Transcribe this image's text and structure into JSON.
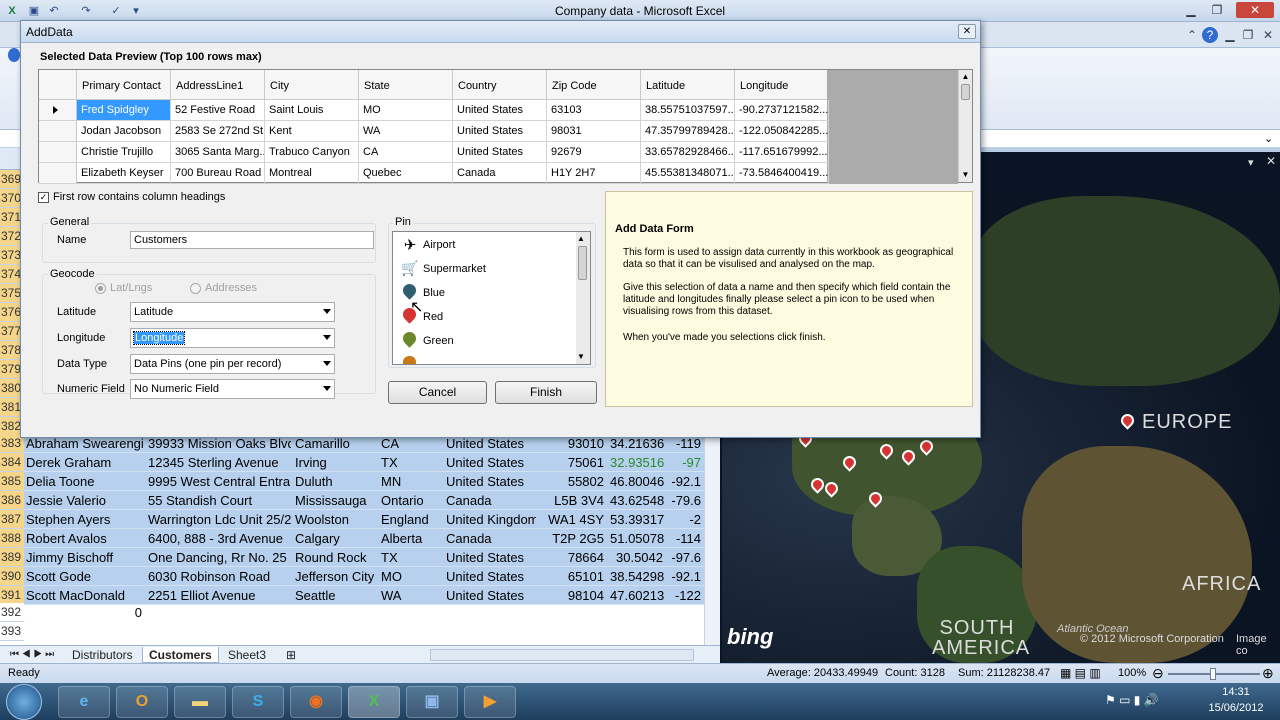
{
  "excel": {
    "window_title": "Company data - Microsoft Excel",
    "status_ready": "Ready",
    "status_average": "Average: 20433.49949",
    "status_count": "Count: 3128",
    "status_sum": "Sum: 21128238.47",
    "zoom": "100%",
    "sheet_tabs": [
      "Distributors",
      "Customers",
      "Sheet3"
    ],
    "active_tab": "Customers",
    "hidden_row_numbers": [
      "369",
      "370",
      "371",
      "372",
      "373",
      "374",
      "375",
      "376",
      "377",
      "378",
      "379",
      "380",
      "381",
      "382"
    ],
    "rows": [
      {
        "n": "383",
        "name": "Abraham Swearengi",
        "addr": "39933 Mission Oaks Blvd",
        "city": "Camarillo",
        "state": "CA",
        "country": "United States",
        "zip": "93010",
        "lat": "34.21636",
        "lng": "-119"
      },
      {
        "n": "384",
        "name": "Derek Graham",
        "addr": "12345 Sterling Avenue",
        "city": "Irving",
        "state": "TX",
        "country": "United States",
        "zip": "75061",
        "lat": "32.93516",
        "lng": "-97"
      },
      {
        "n": "385",
        "name": "Delia Toone",
        "addr": "9995 West Central Entran",
        "city": "Duluth",
        "state": "MN",
        "country": "United States",
        "zip": "55802",
        "lat": "46.80046",
        "lng": "-92.1"
      },
      {
        "n": "386",
        "name": "Jessie Valerio",
        "addr": "55 Standish Court",
        "city": "Mississauga",
        "state": "Ontario",
        "country": "Canada",
        "zip": "L5B 3V4",
        "lat": "43.62548",
        "lng": "-79.6"
      },
      {
        "n": "387",
        "name": "Stephen Ayers",
        "addr": "Warrington Ldc Unit 25/2",
        "city": "Woolston",
        "state": "England",
        "country": "United Kingdom",
        "zip": "WA1 4SY",
        "lat": "53.39317",
        "lng": "-2"
      },
      {
        "n": "388",
        "name": "Robert Avalos",
        "addr": "6400, 888 - 3rd Avenue",
        "city": "Calgary",
        "state": "Alberta",
        "country": "Canada",
        "zip": "T2P 2G5",
        "lat": "51.05078",
        "lng": "-114"
      },
      {
        "n": "389",
        "name": "Jimmy Bischoff",
        "addr": "One Dancing, Rr No. 25",
        "city": "Round Rock",
        "state": "TX",
        "country": "United States",
        "zip": "78664",
        "lat": "30.5042",
        "lng": "-97.6"
      },
      {
        "n": "390",
        "name": "Scott Gode",
        "addr": "6030 Robinson Road",
        "city": "Jefferson City",
        "state": "MO",
        "country": "United States",
        "zip": "65101",
        "lat": "38.54298",
        "lng": "-92.1"
      },
      {
        "n": "391",
        "name": "Scott MacDonald",
        "addr": "2251 Elliot Avenue",
        "city": "Seattle",
        "state": "WA",
        "country": "United States",
        "zip": "98104",
        "lat": "47.60213",
        "lng": "-122"
      }
    ],
    "row392": {
      "n": "392",
      "value": "0"
    },
    "row393": {
      "n": "393"
    }
  },
  "map": {
    "labels": {
      "europe": "EUROPE",
      "africa": "AFRICA",
      "south_america": "SOUTH AMERICA",
      "ocean": "Atlantic Ocean"
    },
    "copyright": "© 2012 Microsoft Corporation",
    "image_credit": "Image co",
    "logo": "bing"
  },
  "dialog": {
    "title": "AddData",
    "preview_heading": "Selected Data Preview (Top 100 rows max)",
    "columns": [
      "Primary Contact",
      "AddressLine1",
      "City",
      "State",
      "Country",
      "Zip Code",
      "Latitude",
      "Longitude"
    ],
    "rows": [
      [
        "Fred Spidgley",
        "52 Festive Road",
        "Saint Louis",
        "MO",
        "United States",
        "63103",
        "38.55751037597...",
        "-90.2737121582..."
      ],
      [
        "Jodan Jacobson",
        "2583 Se 272nd St",
        "Kent",
        "WA",
        "United States",
        "98031",
        "47.35799789428...",
        "-122.050842285..."
      ],
      [
        "Christie Trujillo",
        "3065 Santa Marg...",
        "Trabuco Canyon",
        "CA",
        "United States",
        "92679",
        "33.65782928466...",
        "-117.651679992..."
      ],
      [
        "Elizabeth Keyser",
        "700 Bureau Road",
        "Montreal",
        "Quebec",
        "Canada",
        "H1Y 2H7",
        "45.55381348071...",
        "-73.5846400419..."
      ]
    ],
    "first_row_headings": "First row contains column headings",
    "general_label": "General",
    "name_label": "Name",
    "name_value": "Customers",
    "geocode_label": "Geocode",
    "radio_latlngs": "Lat/Lngs",
    "radio_addresses": "Addresses",
    "latitude_label": "Latitude",
    "latitude_value": "Latitude",
    "longitude_label": "Longitude",
    "longitude_value": "Longitude",
    "datatype_label": "Data Type",
    "datatype_value": "Data Pins (one pin per record)",
    "numeric_label": "Numeric Field",
    "numeric_value": "No Numeric Field",
    "pin_label": "Pin",
    "pins": [
      "Airport",
      "Supermarket",
      "Blue",
      "Red",
      "Green"
    ],
    "cancel": "Cancel",
    "finish": "Finish",
    "info_title": "Add Data Form",
    "info_p1": "This form is used to assign data currently in this workbook as geographical data so that it can be visulised and analysed on the map.",
    "info_p2": "Give this selection of data a name and then specify which field contain the latitude and longitudes finally please select a pin icon to be used when visualising rows from this dataset.",
    "info_p3": "When you've made you selections click finish."
  },
  "taskbar": {
    "time": "14:31",
    "date": "15/06/2012"
  },
  "colors": {
    "selection_blue": "#3399ff",
    "sheet_highlight": "#b6d0ee",
    "pin_red": "#d63333",
    "info_bg": "#fdfbe0"
  }
}
